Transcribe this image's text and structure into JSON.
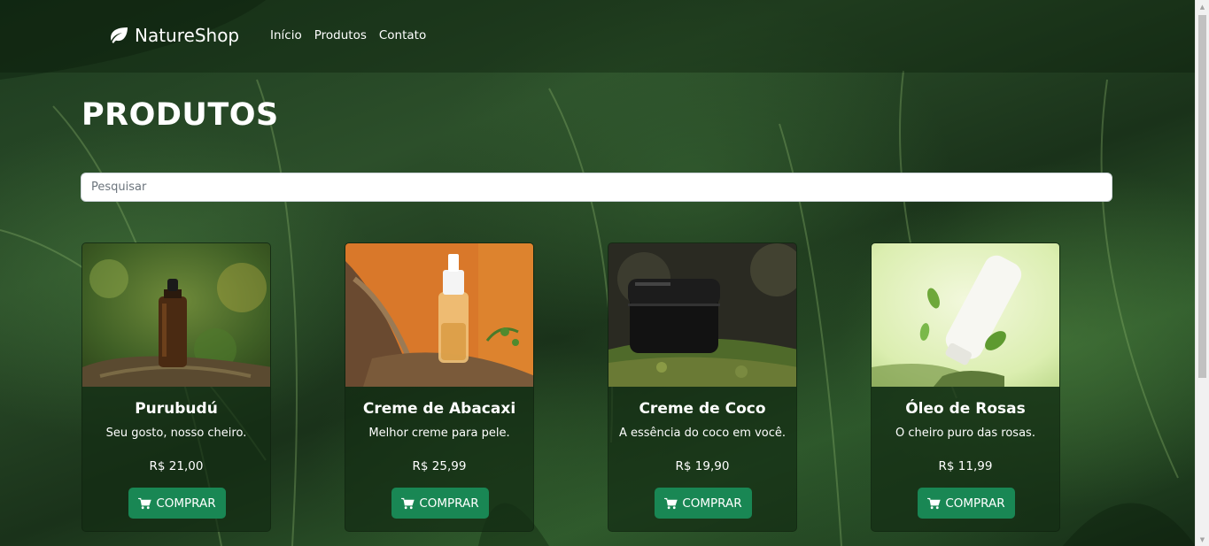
{
  "navbar": {
    "brand": "NatureShop",
    "brand_icon": "leaf-icon",
    "links": [
      "Início",
      "Produtos",
      "Contato"
    ]
  },
  "page": {
    "title": "PRODUTOS"
  },
  "search": {
    "placeholder": "Pesquisar",
    "value": ""
  },
  "products": [
    {
      "name": "Purubudú",
      "description": "Seu gosto, nosso cheiro.",
      "price": "R$ 21,00",
      "button": "COMPRAR",
      "image": "amber-dropper-bottle-in-forest"
    },
    {
      "name": "Creme de Abacaxi",
      "description": "Melhor creme para pele.",
      "price": "R$ 25,99",
      "button": "COMPRAR",
      "image": "pump-bottle-on-driftwood-orange"
    },
    {
      "name": "Creme de Coco",
      "description": "A essência do coco em você.",
      "price": "R$ 19,90",
      "button": "COMPRAR",
      "image": "black-jar-on-mossy-rock"
    },
    {
      "name": "Óleo de Rosas",
      "description": "O cheiro puro das rosas.",
      "price": "R$ 11,99",
      "button": "COMPRAR",
      "image": "white-tube-with-leaves"
    }
  ],
  "colors": {
    "button": "#198754",
    "card_bg": "#142d14",
    "text": "#ffffff"
  }
}
